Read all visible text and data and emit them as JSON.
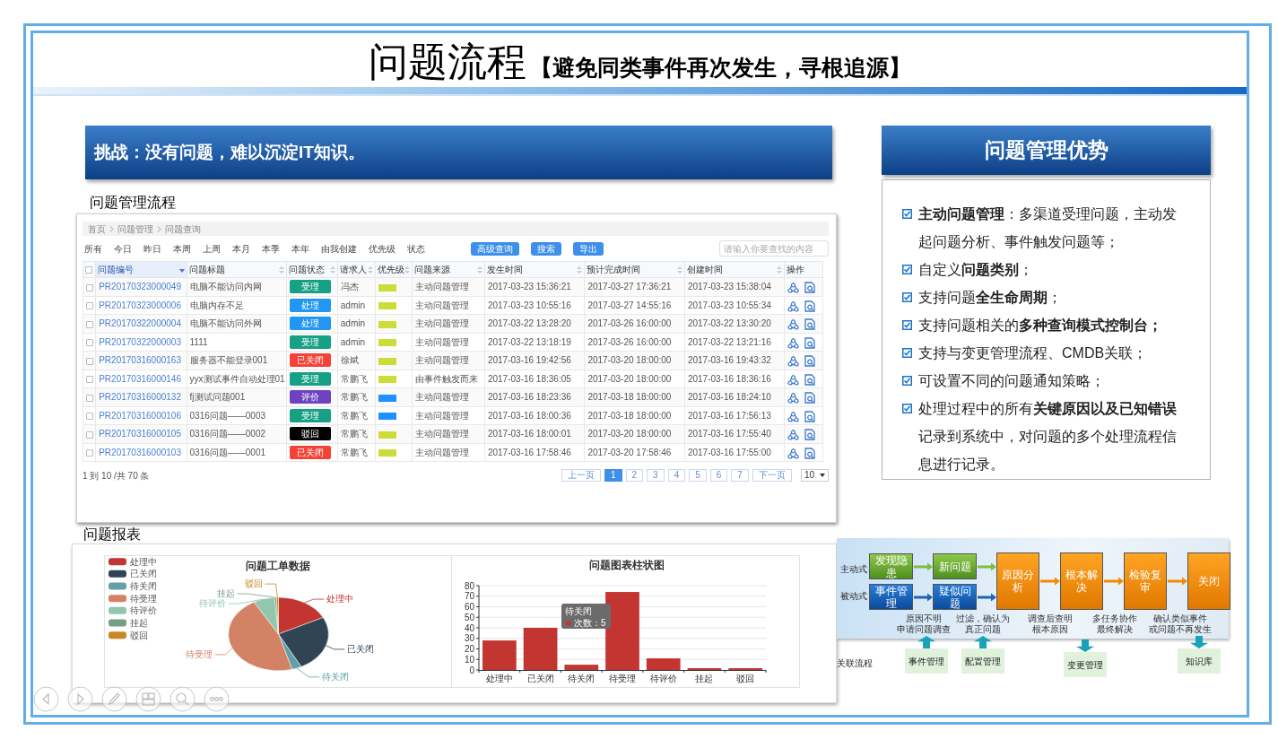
{
  "title": {
    "main": "问题流程",
    "subtitle": "【避免同类事件再次发生，寻根追源】"
  },
  "challenge": "挑战：没有问题，难以沉淀IT知识。",
  "process_label": "问题管理流程",
  "problem_list": {
    "breadcrumb": [
      "首页",
      "问题管理",
      "问题查询"
    ],
    "header_checked": false,
    "filters": [
      "所有",
      "今日",
      "昨日",
      "本周",
      "上周",
      "本月",
      "本季",
      "本年",
      "由我创建",
      "优先级",
      "状态"
    ],
    "buttons": [
      "高级查询",
      "搜索",
      "导出"
    ],
    "search": {
      "placeholder": "请输入你要查找的内容"
    },
    "columns": [
      {
        "label": "问题编号",
        "sortable": true,
        "sorted": true,
        "kind": "link"
      },
      {
        "label": "问题标题",
        "sortable": true,
        "sorted": false,
        "kind": "text"
      },
      {
        "label": "问题状态",
        "sortable": true,
        "sorted": false,
        "kind": "status"
      },
      {
        "label": "请求人",
        "sortable": true,
        "sorted": false,
        "kind": "text"
      },
      {
        "label": "优先级",
        "sortable": true,
        "sorted": false,
        "kind": "priority"
      },
      {
        "label": "问题来源",
        "sortable": true,
        "sorted": false,
        "kind": "text"
      },
      {
        "label": "发生时间",
        "sortable": true,
        "sorted": false,
        "kind": "text"
      },
      {
        "label": "预计完成时间",
        "sortable": true,
        "sorted": false,
        "kind": "text"
      },
      {
        "label": "创建时间",
        "sortable": true,
        "sorted": false,
        "kind": "text"
      },
      {
        "label": "操作",
        "sortable": false,
        "sorted": false,
        "kind": "actions"
      }
    ],
    "rows": [
      {
        "checked": false,
        "cells": [
          "PR20170323000049",
          "电脑不能访问内网",
          {
            "label": "受理",
            "color": "#16a085"
          },
          "冯杰",
          {
            "color": "#cddc39"
          },
          "主动问题管理",
          "2017-03-23 15:36:21",
          "2017-03-27 17:36:21",
          "2017-03-23 15:38:04"
        ]
      },
      {
        "checked": false,
        "cells": [
          "PR20170323000006",
          "电脑内存不足",
          {
            "label": "处理",
            "color": "#2196f3"
          },
          "admin",
          {
            "color": "#cddc39"
          },
          "主动问题管理",
          "2017-03-23 10:55:16",
          "2017-03-27 14:55:16",
          "2017-03-23 10:55:34"
        ]
      },
      {
        "checked": false,
        "cells": [
          "PR20170322000004",
          "电脑不能访问外网",
          {
            "label": "处理",
            "color": "#2196f3"
          },
          "admin",
          {
            "color": "#cddc39"
          },
          "主动问题管理",
          "2017-03-22 13:28:20",
          "2017-03-26 16:00:00",
          "2017-03-22 13:30:20"
        ]
      },
      {
        "checked": false,
        "cells": [
          "PR20170322000003",
          "1111",
          {
            "label": "受理",
            "color": "#16a085"
          },
          "admin",
          {
            "color": "#cddc39"
          },
          "主动问题管理",
          "2017-03-22 13:18:19",
          "2017-03-26 16:00:00",
          "2017-03-22 13:21:16"
        ]
      },
      {
        "checked": false,
        "cells": [
          "PR20170316000163",
          "服务器不能登录001",
          {
            "label": "已关闭",
            "color": "#f44336"
          },
          "徐斌",
          {
            "color": "#cddc39"
          },
          "主动问题管理",
          "2017-03-16 19:42:56",
          "2017-03-20 18:00:00",
          "2017-03-16 19:43:32"
        ]
      },
      {
        "checked": false,
        "cells": [
          "PR20170316000146",
          "yyx测试事件自动处理01",
          {
            "label": "受理",
            "color": "#16a085"
          },
          "常鹏飞",
          {
            "color": "#cddc39"
          },
          "由事件触发而来",
          "2017-03-16 18:36:05",
          "2017-03-20 18:00:00",
          "2017-03-16 18:36:16"
        ]
      },
      {
        "checked": false,
        "cells": [
          "PR20170316000132",
          "fj测试问题001",
          {
            "label": "评价",
            "color": "#6f42c1"
          },
          "常鹏飞",
          {
            "color": "#1e90ff"
          },
          "主动问题管理",
          "2017-03-16 18:23:36",
          "2017-03-18 18:00:00",
          "2017-03-16 18:24:10"
        ]
      },
      {
        "checked": false,
        "cells": [
          "PR20170316000106",
          "0316问题——0003",
          {
            "label": "受理",
            "color": "#16a085"
          },
          "常鹏飞",
          {
            "color": "#1e90ff"
          },
          "主动问题管理",
          "2017-03-16 18:00:36",
          "2017-03-18 18:00:00",
          "2017-03-16 17:56:13"
        ]
      },
      {
        "checked": false,
        "cells": [
          "PR20170316000105",
          "0316问题——0002",
          {
            "label": "驳回",
            "color": "#000000"
          },
          "常鹏飞",
          {
            "color": "#cddc39"
          },
          "主动问题管理",
          "2017-03-16 18:00:01",
          "2017-03-20 18:00:00",
          "2017-03-16 17:55:40"
        ]
      },
      {
        "checked": false,
        "cells": [
          "PR20170316000103",
          "0316问题——0001",
          {
            "label": "已关闭",
            "color": "#f44336"
          },
          "常鹏飞",
          {
            "color": "#cddc39"
          },
          "主动问题管理",
          "2017-03-16 17:58:46",
          "2017-03-20 17:58:46",
          "2017-03-16 17:55:00"
        ]
      }
    ],
    "summary": "1 到 10 /共 70 条",
    "pagination": {
      "prev": "上一页",
      "pages": [
        {
          "label": "1",
          "selected": true
        },
        {
          "label": "2",
          "selected": false
        },
        {
          "label": "3",
          "selected": false
        },
        {
          "label": "4",
          "selected": false
        },
        {
          "label": "5",
          "selected": false
        },
        {
          "label": "6",
          "selected": false
        },
        {
          "label": "7",
          "selected": false
        }
      ],
      "next": "下一页",
      "page_size": "10"
    }
  },
  "report_label": "问题报表",
  "pie": {
    "title": "问题工单数据",
    "legend": [
      {
        "label": "处理中",
        "color": "#c23531"
      },
      {
        "label": "已关闭",
        "color": "#2f4554"
      },
      {
        "label": "待关闭",
        "color": "#61a0a8"
      },
      {
        "label": "待受理",
        "color": "#d48265"
      },
      {
        "label": "待评价",
        "color": "#91c7ae"
      },
      {
        "label": "挂起",
        "color": "#749f83"
      },
      {
        "label": "驳回",
        "color": "#ca8622"
      }
    ],
    "slice_labels": [
      "处理中",
      "已关闭",
      "待关闭",
      "待受理",
      "待评价",
      "挂起",
      "驳回"
    ]
  },
  "bar": {
    "chart_data": {
      "type": "bar",
      "title": "问题图表柱状图",
      "categories": [
        "处理中",
        "已关闭",
        "待关闭",
        "待受理",
        "待评价",
        "挂起",
        "驳回"
      ],
      "series": [
        {
          "color": "#c23531",
          "values": [
            28,
            40,
            5,
            74,
            11,
            1,
            1
          ]
        }
      ],
      "ylim": [
        0,
        80
      ],
      "grid": true,
      "yticks": [
        0,
        10,
        20,
        30,
        40,
        50,
        60,
        70,
        80
      ]
    },
    "tooltip": {
      "title": "待关闭",
      "text": "次数：5"
    }
  },
  "advantages": {
    "title": "问题管理优势",
    "items": [
      {
        "checked": true,
        "text": "**主动问题管理**：多渠道受理问题，主动发起问题分析、事件触发问题等；"
      },
      {
        "checked": true,
        "text": "自定义**问题类别**；"
      },
      {
        "checked": true,
        "text": "支持问题**全生命周期**；"
      },
      {
        "checked": true,
        "text": "支持问题相关的**多种查询模式控制台；**"
      },
      {
        "checked": true,
        "text": "支持与变更管理流程、CMDB关联；"
      },
      {
        "checked": true,
        "text": "可设置不同的问题通知策略；"
      },
      {
        "checked": true,
        "text": "处理过程中的所有**关键原因以及已知错误**记录到系统中，对问题的多个处理流程信息进行记录。"
      }
    ]
  },
  "flow": {
    "modes": [
      "主动式",
      "被动式"
    ],
    "steps": [
      {
        "label": "发现隐患",
        "kind": "proactive"
      },
      {
        "label": "新问题",
        "kind": "proactive"
      },
      {
        "label": "事件管理",
        "kind": "reactive"
      },
      {
        "label": "疑似问题",
        "kind": "reactive"
      },
      {
        "label": "原因分析",
        "kind": "stage"
      },
      {
        "label": "根本解决",
        "kind": "stage"
      },
      {
        "label": "检验复审",
        "kind": "stage"
      },
      {
        "label": "关闭",
        "kind": "stage"
      }
    ],
    "notes": [
      [
        "原因不明",
        "申请问题调查"
      ],
      [
        "过滤，确认为",
        "真正问题"
      ],
      [
        "调查后查明",
        "根本原因"
      ],
      [
        "多任务协作",
        "最终解决"
      ],
      [
        "确认类似事件",
        "或问题不再发生"
      ]
    ],
    "related_label": "关联流程",
    "related": [
      {
        "label": "事件管理",
        "upward": true
      },
      {
        "label": "配置管理",
        "upward": true
      },
      {
        "label": "变更管理",
        "upward": false
      },
      {
        "label": "知识库",
        "upward": false
      }
    ]
  }
}
